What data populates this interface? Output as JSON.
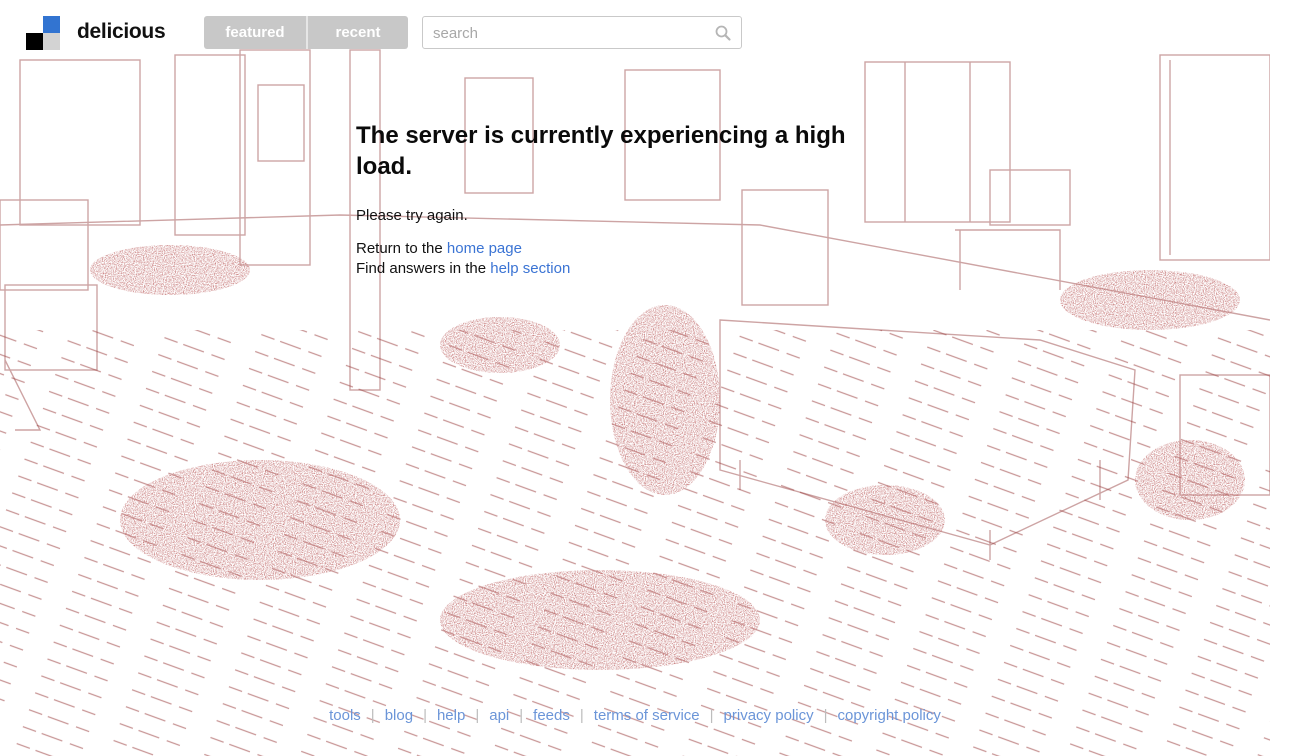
{
  "header": {
    "brand": "delicious",
    "tabs": [
      {
        "label": "featured"
      },
      {
        "label": "recent"
      }
    ],
    "search": {
      "placeholder": "search",
      "value": ""
    }
  },
  "main": {
    "title": "The server is currently experiencing a high load.",
    "message": "Please try again.",
    "return_prefix": "Return to the",
    "return_link": "home page",
    "help_prefix": "Find answers in the",
    "help_link": "help section"
  },
  "footer": {
    "links": [
      "tools",
      "blog",
      "help",
      "api",
      "feeds",
      "terms of service",
      "privacy policy",
      "copyright policy"
    ],
    "separator": "|"
  },
  "colors": {
    "logo_blue": "#3274d1",
    "logo_black": "#000000",
    "logo_gray": "#d3d3d3",
    "tab_bg": "#c8c8c8",
    "link": "#3b74d4",
    "footer_link": "#6b95d8",
    "sketch": "#8b2a2a"
  },
  "icons": {
    "search": "magnifier-icon"
  }
}
